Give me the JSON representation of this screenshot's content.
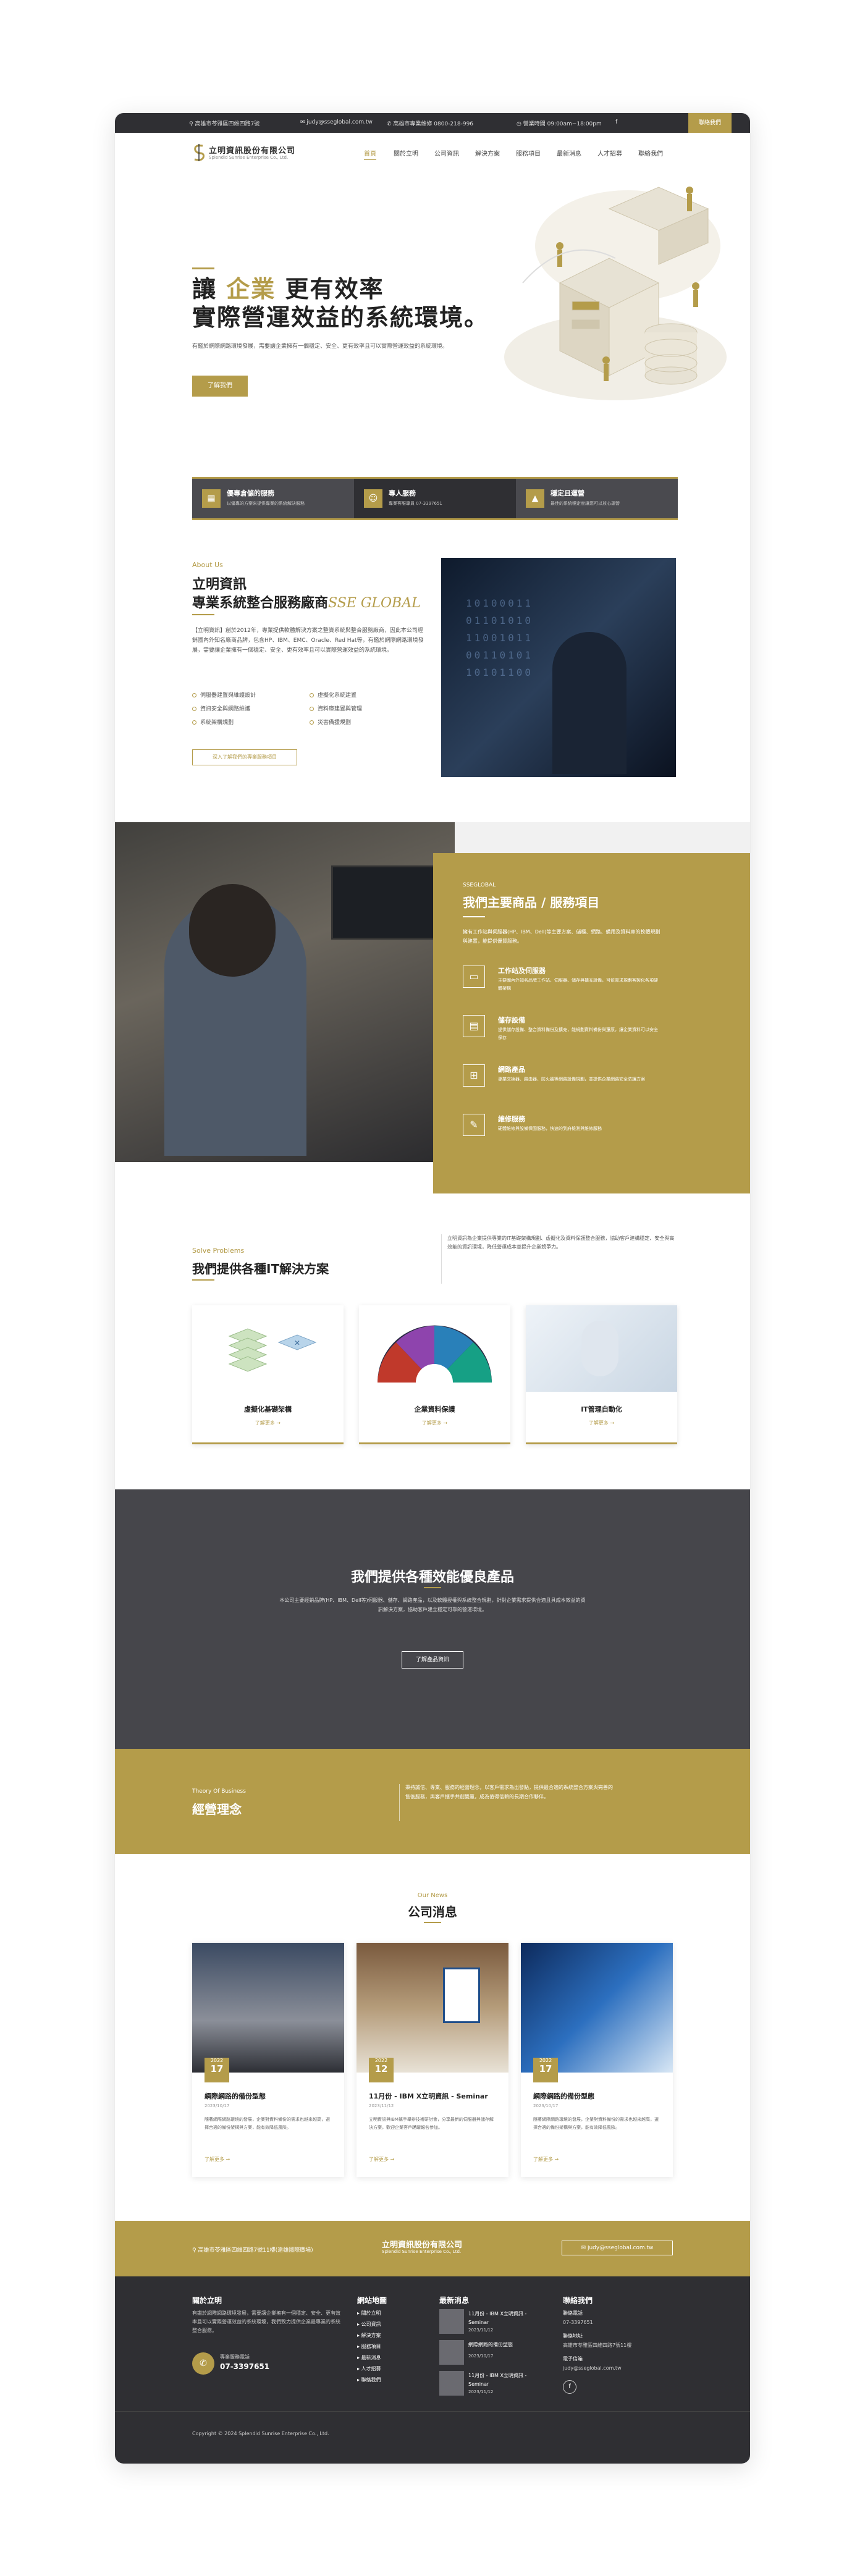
{
  "topbar": {
    "address": "高雄市苓雅區四維四路7號",
    "email": "judy@sseglobal.com.tw",
    "phone": "高雄市專業維修 0800-218-996",
    "hours": "營業時間 09:00am~18:00pm",
    "facebook": "f",
    "cta": "聯絡我們"
  },
  "brand": {
    "name": "立明資訊股份有限公司",
    "sub": "Splendid Sunrise Enterprise Co., Ltd."
  },
  "menu": [
    "首頁",
    "關於立明",
    "公司資訊",
    "解決方案",
    "服務項目",
    "最新消息",
    "人才招募",
    "聯絡我們"
  ],
  "hero": {
    "line1a": "讓",
    "line1b": "企業",
    "line1c": "更有效率",
    "line2": "實際營運效益的系統環境。",
    "desc": "有鑑於網際網路環境發展，需要讓企業擁有一個穩定、安全、更有效率且可以實際營運效益的系統環境。",
    "button": "了解我們"
  },
  "features": [
    {
      "title": "優專倉儲的服務",
      "desc": "以優專的方案來提供專業的系統解決服務"
    },
    {
      "title": "專人服務",
      "desc": "專業客服專員 07-3397651"
    },
    {
      "title": "穩定且運營",
      "desc": "最佳的系統穩定度讓您可以放心運營"
    }
  ],
  "about": {
    "tag": "About Us",
    "title1": "立明資訊",
    "title2": "專業系統整合服務廠商",
    "title2b": "SSE GLOBAL",
    "desc": "【立明資訊】創於2012年，專業提供軟體解決方案之整資系統與整合服務廠商，因此本公司經銷國內外知名廠商品牌，包含HP、IBM、EMC、Oracle、Red Hat等，有鑑於網際網路環境發展，需要讓企業擁有一個穩定、安全、更有效率且可以實際營運效益的系統環境。",
    "bullets": [
      "伺服器建置與維護設計",
      "虛擬化系統建置",
      "資訊安全與網路維護",
      "資料庫建置與管理",
      "系統架構規劃",
      "災害備援規劃"
    ],
    "button": "深入了解我們的專業服務項目"
  },
  "services": {
    "tag": "SSEGLOBAL",
    "title": "我們主要商品 / 服務項目",
    "desc": "擁有工作站與伺服器(HP、IBM、Dell)等主要方案、儲櫃、網路、備用及資料庫的軟體規劃與建置，能提供優質服務。",
    "items": [
      {
        "title": "工作站及伺服器",
        "desc": "主要國內外知名品牌工作站、伺服器、儲存與擴充設備，可依需求規劃客製化各項硬體架構"
      },
      {
        "title": "儲存設備",
        "desc": "提供儲存設備、整合資料備份及擴充，能規劃資料備份與還原，讓企業資料可以安全保存"
      },
      {
        "title": "網路產品",
        "desc": "專業交換器、路由器、防火牆等網路設備規劃，並提供企業網路安全防護方案"
      },
      {
        "title": "維修服務",
        "desc": "硬體維修與設備保固服務，快速的到府檢測與維修服務"
      }
    ]
  },
  "solutions": {
    "tag": "Solve Problems",
    "title": "我們提供各種IT解決方案",
    "desc": "立明資訊為企業提供專業的IT基礎架構規劃、虛擬化及資料保護整合服務，協助客戶建構穩定、安全與高效能的資訊環境，降低營運成本並提升企業競爭力。",
    "cards": [
      {
        "title": "虛擬化基礎架構",
        "link": "了解更多 →"
      },
      {
        "title": "企業資料保護",
        "link": "了解更多 →"
      },
      {
        "title": "IT管理自動化",
        "link": "了解更多 →"
      }
    ]
  },
  "products": {
    "title": "我們提供各種效能優良產品",
    "desc": "本公司主要經銷品牌(HP、IBM、Dell等)伺服器、儲存、網路產品，以及軟體授權與系統整合規劃，針對企業需求提供合適且具成本效益的資訊解決方案，協助客戶建立穩定可靠的營運環境。",
    "button": "了解產品資訊"
  },
  "business": {
    "tag": "Theory Of Business",
    "title": "經營理念",
    "desc": "秉持誠信、專業、服務的經營理念，以客戶需求為出發點，提供最合適的系統整合方案與完善的售後服務，與客戶攜手共創雙贏，成為值得信賴的長期合作夥伴。"
  },
  "newsSection": {
    "tag": "Our News",
    "title": "公司消息",
    "items": [
      {
        "month": "2022",
        "day": "17",
        "title": "網際網路的備份型態",
        "date": "2023/10/17",
        "excerpt": "隨著網際網路環境的發展，企業對資料備份的需求也越來越高，選擇合適的備份架構與方案，能有效降低風險。",
        "link": "了解更多 →"
      },
      {
        "month": "2022",
        "day": "12",
        "title": "11月份 - IBM X立明資訊 - Seminar",
        "date": "2023/11/12",
        "excerpt": "立明資訊與IBM攜手舉辦技術研討會，分享最新的伺服器與儲存解決方案，歡迎企業客戶踴躍報名參加。",
        "link": "了解更多 →"
      },
      {
        "month": "2022",
        "day": "17",
        "title": "網際網路的備份型態",
        "date": "2023/10/17",
        "excerpt": "隨著網際網路環境的發展，企業對資料備份的需求也越來越高，選擇合適的備份架構與方案，能有效降低風險。",
        "link": "了解更多 →"
      }
    ]
  },
  "contactBar": {
    "address": "高雄市苓雅區四維四路7號11樓(遠雄國際廣場)",
    "email": "judy@sseglobal.com.tw"
  },
  "footer": {
    "aboutTitle": "關於立明",
    "aboutText": "有鑑於網際網路環境發展，需要讓企業擁有一個穩定、安全、更有效率且可以實際營運效益的系統環境，我們致力提供企業最專業的系統整合服務。",
    "serviceLabel": "專業服務電話",
    "servicePhone": "07-3397651",
    "linksTitle": "網站地圖",
    "links": [
      "關於立明",
      "公司資訊",
      "解決方案",
      "服務項目",
      "最新消息",
      "人才招募",
      "聯絡我們"
    ],
    "newsTitle": "最新消息",
    "news": [
      {
        "title": "11月份 - IBM X立明資訊 - Seminar",
        "date": "2023/11/12"
      },
      {
        "title": "網際網路的備份型態",
        "date": "2023/10/17"
      },
      {
        "title": "11月份 - IBM X立明資訊 - Seminar",
        "date": "2023/11/12"
      }
    ],
    "contactTitle": "聯絡我們",
    "contact": [
      {
        "label": "聯絡電話",
        "value": "07-3397651"
      },
      {
        "label": "聯絡地址",
        "value": "高雄市苓雅區四維四路7號11樓"
      },
      {
        "label": "電子信箱",
        "value": "judy@sseglobal.com.tw"
      }
    ],
    "social": "f",
    "copyright": "Copyright © 2024 Splendid Sunrise Enterprise Co., Ltd."
  },
  "colors": {
    "gold": "#b49c4a",
    "dark": "#2f2f33",
    "gray": "#4a4a4f"
  }
}
